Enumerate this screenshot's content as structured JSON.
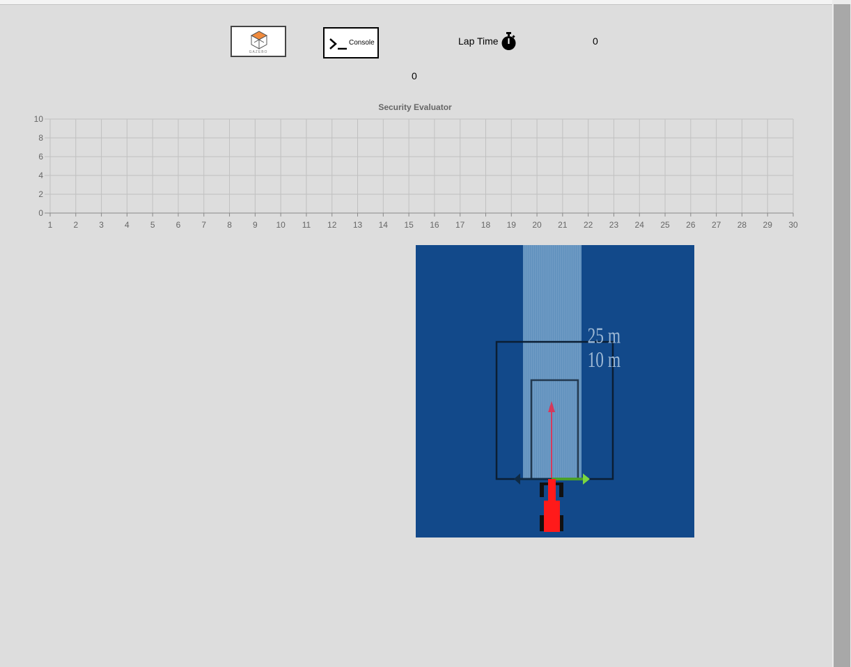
{
  "toolbar": {
    "gazebo_logo_text": "GAZEBO",
    "console_label": "Console"
  },
  "lap": {
    "label": "Lap Time",
    "value": "0"
  },
  "evaluator": {
    "value": "0"
  },
  "chart_data": {
    "type": "line",
    "title": "Security Evaluator",
    "x": [
      1,
      2,
      3,
      4,
      5,
      6,
      7,
      8,
      9,
      10,
      11,
      12,
      13,
      14,
      15,
      16,
      17,
      18,
      19,
      20,
      21,
      22,
      23,
      24,
      25,
      26,
      27,
      28,
      29,
      30
    ],
    "y_ticks": [
      0,
      2,
      4,
      6,
      8,
      10
    ],
    "ylim": [
      0,
      10
    ],
    "xlim": [
      1,
      30
    ],
    "grid": true,
    "series": []
  },
  "visualization": {
    "label_25m": "25 m",
    "label_10m": "10 m",
    "background_color": "#12498a",
    "car_color": "#ff1a1a"
  }
}
